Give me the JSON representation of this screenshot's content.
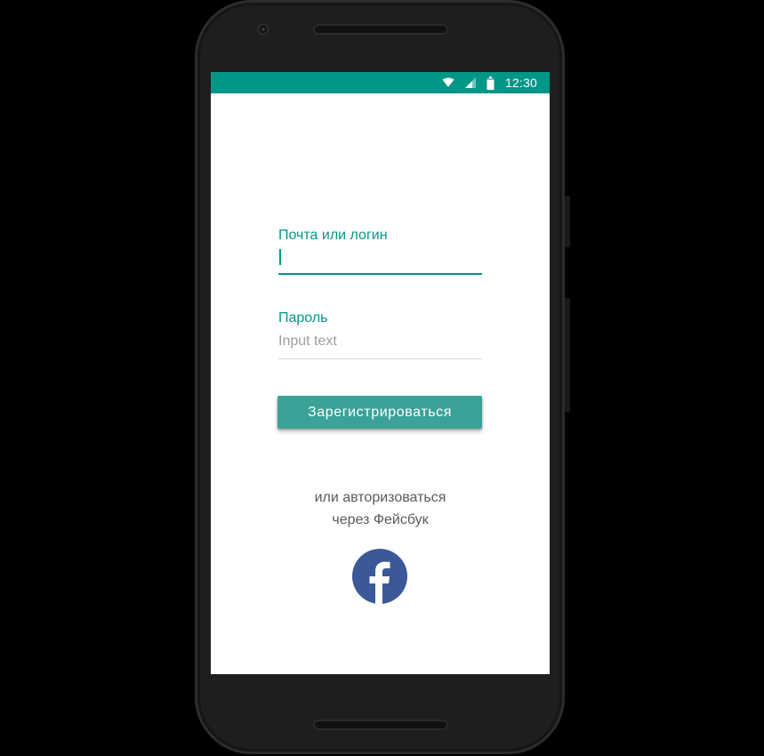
{
  "status_bar": {
    "time": "12:30",
    "icons": [
      "wifi-icon",
      "signal-icon",
      "battery-icon"
    ],
    "color": "#009688"
  },
  "form": {
    "login_label": "Почта или логин",
    "login_value": "",
    "password_label": "Пароль",
    "password_placeholder": "Input text",
    "register_button": "Зарегистрироваться"
  },
  "alternative": {
    "line1": "или авторизоваться",
    "line2": "через Фейсбук",
    "facebook_icon": "facebook-icon",
    "facebook_color": "#3b5998"
  },
  "colors": {
    "accent": "#009688",
    "button": "#3aa297"
  }
}
